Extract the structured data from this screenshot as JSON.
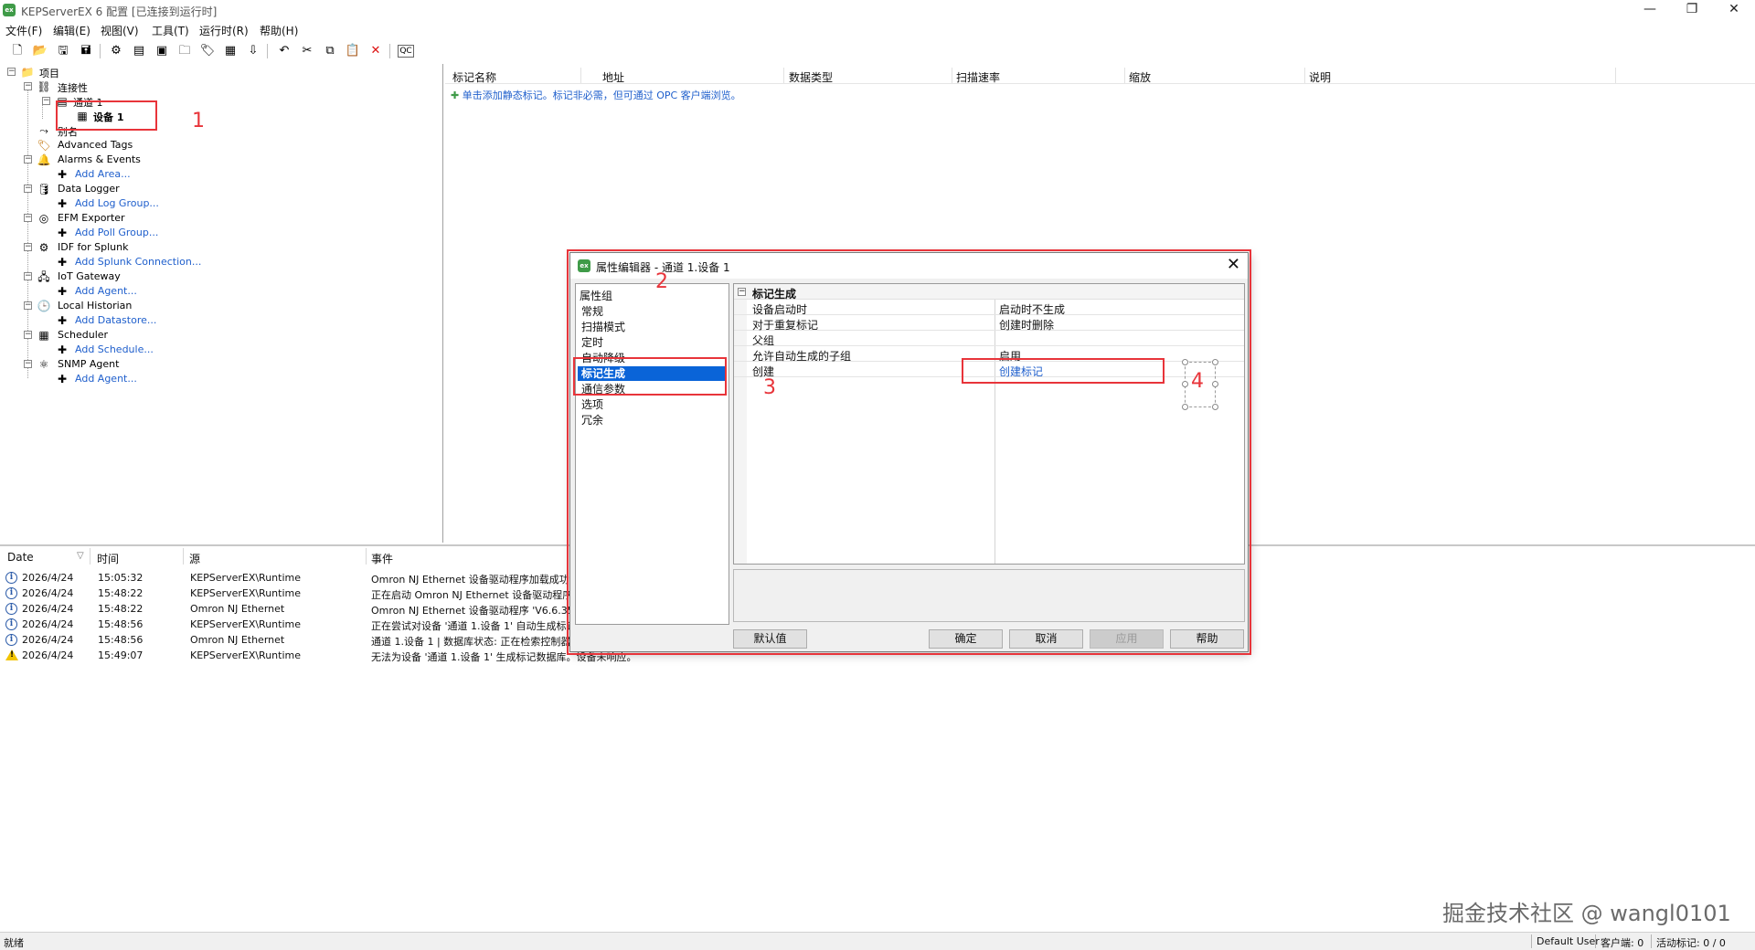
{
  "window": {
    "app_icon": "ex",
    "title": "KEPServerEX 6 配置 [已连接到运行时]",
    "min": "—",
    "max": "❐",
    "close": "✕"
  },
  "menu": [
    "文件(F)",
    "编辑(E)",
    "视图(V)",
    "工具(T)",
    "运行时(R)",
    "帮助(H)"
  ],
  "toolbar_icons": [
    "new-project-icon",
    "open-icon",
    "save-icon",
    "save-as-icon",
    "properties-icon",
    "new-channel-icon",
    "new-device-icon",
    "new-tag-group-icon",
    "new-tag-icon",
    "bulk-tag-icon",
    "import-icon",
    "undo-icon",
    "cut-icon",
    "copy-icon",
    "paste-icon",
    "delete-icon",
    "quick-client-icon"
  ],
  "tree": {
    "project": "项目",
    "connectivity": "连接性",
    "channel": "通道 1",
    "device": "设备 1",
    "aliases": "别名",
    "advanced_tags": "Advanced Tags",
    "alarms_events": "Alarms & Events",
    "add_area": "Add Area...",
    "data_logger": "Data Logger",
    "add_log_group": "Add Log Group...",
    "efm_exporter": "EFM Exporter",
    "add_poll_group": "Add Poll Group...",
    "idf_splunk": "IDF for Splunk",
    "add_splunk_connection": "Add Splunk Connection...",
    "iot_gateway": "IoT Gateway",
    "add_agent_iot": "Add Agent...",
    "local_historian": "Local Historian",
    "add_datastore": "Add Datastore...",
    "scheduler": "Scheduler",
    "add_schedule": "Add Schedule...",
    "snmp_agent": "SNMP Agent",
    "add_agent_snmp": "Add Agent..."
  },
  "tags_panel": {
    "columns": [
      "标记名称",
      "地址",
      "数据类型",
      "扫描速率",
      "缩放",
      "说明"
    ],
    "hint": "单击添加静态标记。标记非必需，但可通过 OPC 客户端浏览。"
  },
  "event_log": {
    "columns": [
      "Date",
      "时间",
      "源",
      "事件"
    ],
    "rows": [
      {
        "type": "info",
        "date": "2026/4/24",
        "time": "15:05:32",
        "source": "KEPServerEX\\Runtime",
        "event": "Omron NJ Ethernet 设备驱动程序加载成功。"
      },
      {
        "type": "info",
        "date": "2026/4/24",
        "time": "15:48:22",
        "source": "KEPServerEX\\Runtime",
        "event": "正在启动 Omron NJ Ethernet 设备驱动程序。"
      },
      {
        "type": "info",
        "date": "2026/4/24",
        "time": "15:48:22",
        "source": "Omron NJ Ethernet",
        "event": "Omron NJ Ethernet 设备驱动程序 'V6.6.350.0'"
      },
      {
        "type": "info",
        "date": "2026/4/24",
        "time": "15:48:56",
        "source": "KEPServerEX\\Runtime",
        "event": "正在尝试对设备 '通道 1.设备 1' 自动生成标记。"
      },
      {
        "type": "info",
        "date": "2026/4/24",
        "time": "15:48:56",
        "source": "Omron NJ Ethernet",
        "event": "通道 1.设备 1 | 数据库状态: 正在检索控制器项目信息。"
      },
      {
        "type": "warn",
        "date": "2026/4/24",
        "time": "15:49:07",
        "source": "KEPServerEX\\Runtime",
        "event": "无法为设备 '通道 1.设备 1' 生成标记数据库。设备未响应。"
      }
    ]
  },
  "status_bar": {
    "ready": "就绪",
    "user": "Default User",
    "clients": "客户端: 0",
    "active_tags": "活动标记: 0 / 0"
  },
  "watermark": "掘金技术社区 @ wangl0101",
  "dialog": {
    "icon": "ex",
    "title": "属性编辑器 - 通道 1.设备 1",
    "close": "✕",
    "groups_header": "属性组",
    "groups": [
      "常规",
      "扫描模式",
      "定时",
      "自动降级",
      "标记生成",
      "通信参数",
      "选项",
      "冗余"
    ],
    "selected_group": "标记生成",
    "category": "标记生成",
    "properties": [
      {
        "name": "设备启动时",
        "value": "启动时不生成"
      },
      {
        "name": "对于重复标记",
        "value": "创建时删除"
      },
      {
        "name": "父组",
        "value": ""
      },
      {
        "name": "允许自动生成的子组",
        "value": "启用"
      },
      {
        "name": "创建",
        "value": "创建标记"
      }
    ],
    "buttons": {
      "defaults": "默认值",
      "ok": "确定",
      "cancel": "取消",
      "apply": "应用",
      "help": "帮助"
    }
  },
  "annotations": [
    "1",
    "2",
    "3",
    "4"
  ],
  "colors": {
    "annotation": "#e8343a",
    "selection": "#0a64d8",
    "link": "#1f5fcc",
    "brand": "#3f9b48"
  }
}
